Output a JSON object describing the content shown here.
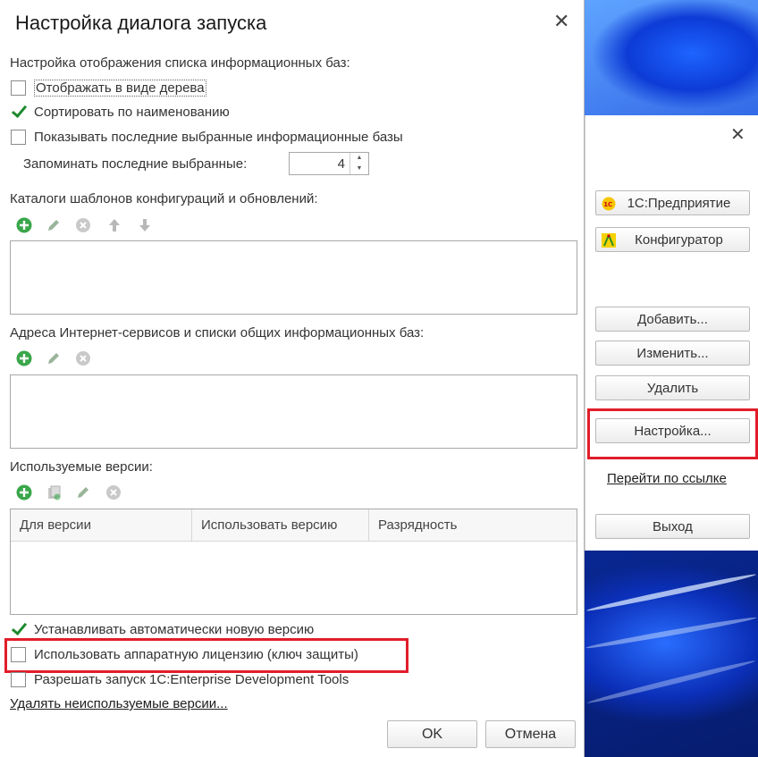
{
  "dialog": {
    "title": "Настройка диалога запуска",
    "list_section_label": "Настройка отображения списка информационных баз:",
    "options": [
      {
        "label": "Отображать в виде дерева",
        "checked": false
      },
      {
        "label": "Сортировать по наименованию",
        "checked": true
      },
      {
        "label": "Показывать последние выбранные информационные базы",
        "checked": false
      }
    ],
    "remember_label": "Запоминать последние выбранные:",
    "remember_value": "4",
    "templates_label": "Каталоги шаблонов конфигураций и обновлений:",
    "internet_label": "Адреса Интернет-сервисов и списки общих информационных баз:",
    "versions_label": "Используемые версии:",
    "versions_columns": [
      "Для версии",
      "Использовать версию",
      "Разрядность"
    ],
    "bottom_options": [
      {
        "label": "Устанавливать автоматически новую версию",
        "checked": true
      },
      {
        "label": "Использовать аппаратную лицензию (ключ защиты)",
        "checked": false
      },
      {
        "label": "Разрешать запуск 1C:Enterprise Development Tools",
        "checked": false
      }
    ],
    "remove_unused_link": "Удалять неиспользуемые версии...",
    "ok_label": "OK",
    "cancel_label": "Отмена",
    "close_glyph": "✕"
  },
  "launcher": {
    "close_glyph": "✕",
    "enterprise_label": "1С:Предприятие",
    "designer_label": "Конфигуратор",
    "add_label": "Добавить...",
    "edit_label": "Изменить...",
    "delete_label": "Удалить",
    "settings_label": "Настройка...",
    "goto_link": "Перейти по ссылке",
    "exit_label": "Выход"
  },
  "colors": {
    "highlight": "#e11d2a",
    "check": "#1e8a2e",
    "add_icon": "#3aa64a"
  },
  "icons": [
    "add-icon",
    "edit-icon",
    "delete-icon",
    "move-up-icon",
    "move-down-icon",
    "copy-icon"
  ]
}
